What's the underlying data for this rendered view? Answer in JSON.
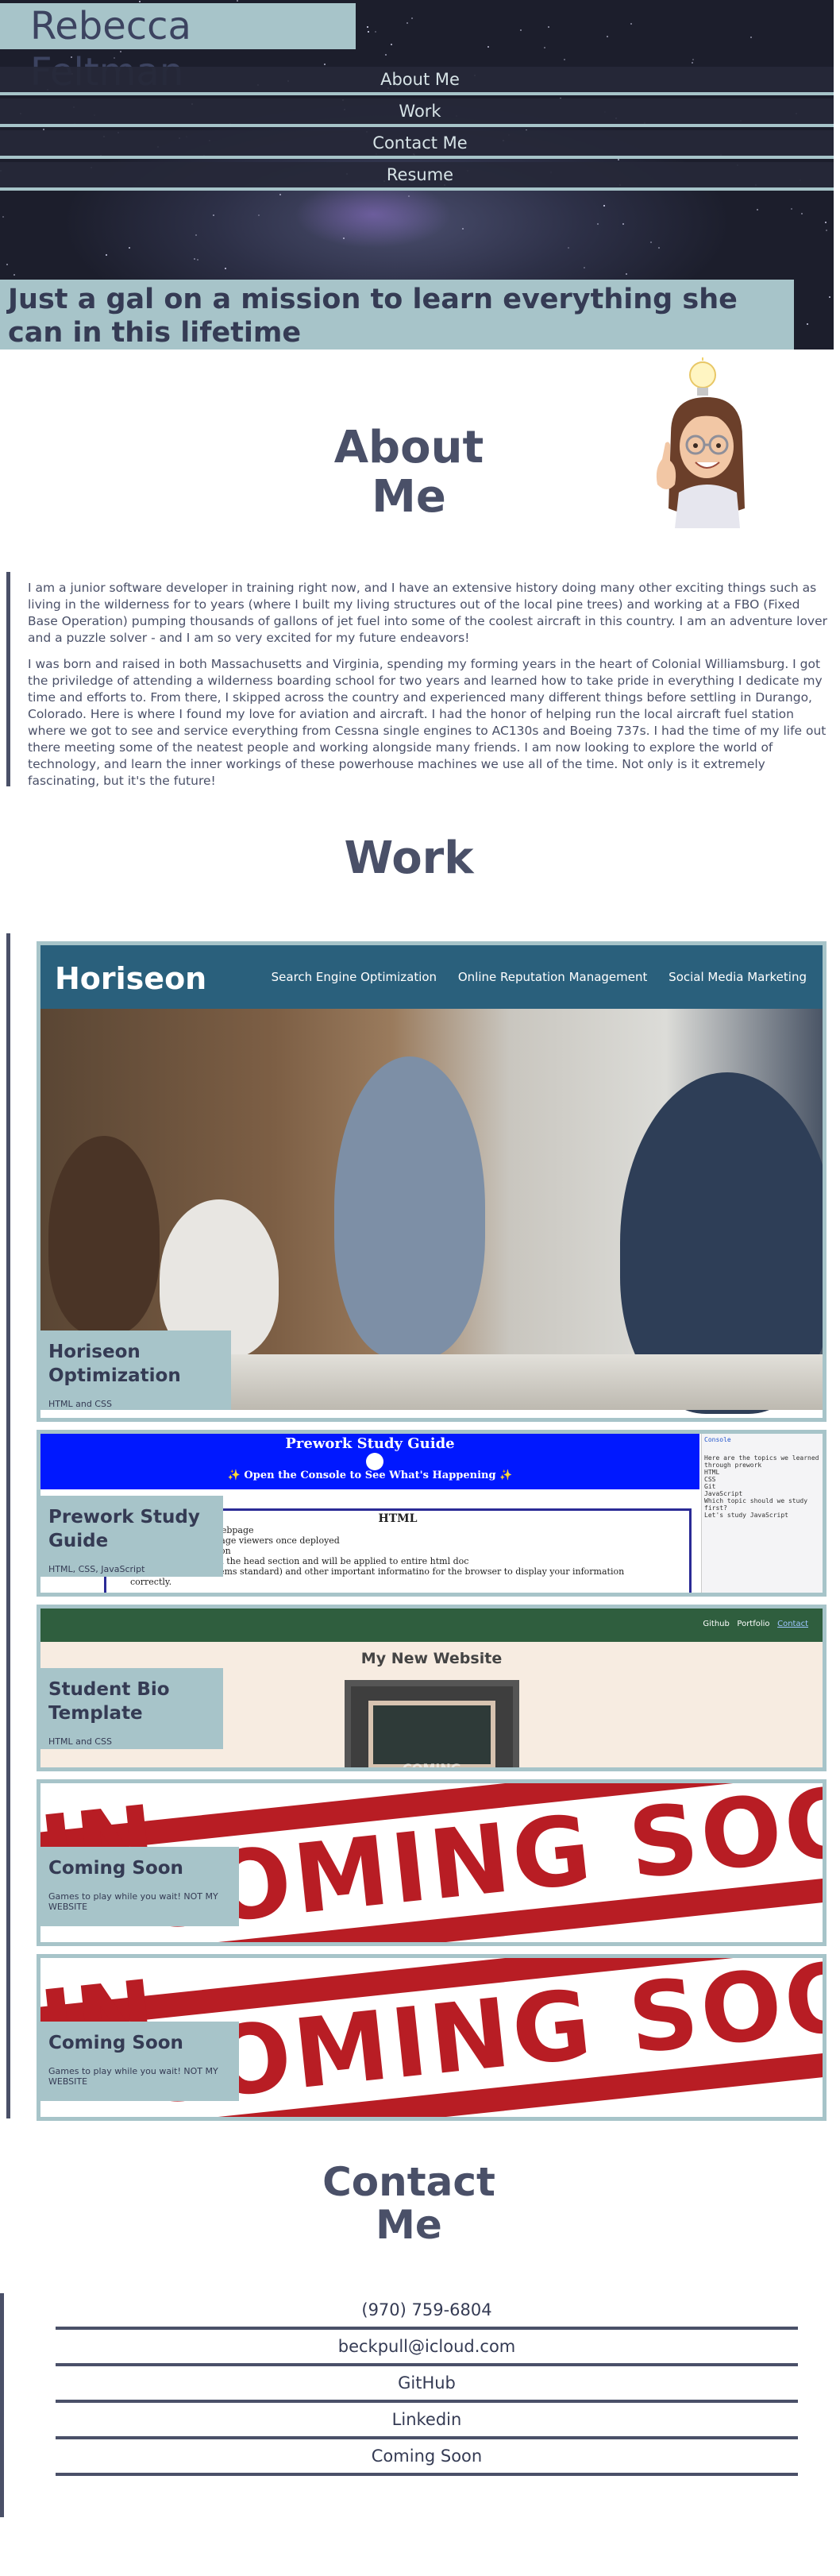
{
  "header": {
    "title": "Rebecca Feltman",
    "nav": [
      "About Me",
      "Work",
      "Contact Me",
      "Resume"
    ],
    "tagline": "Just a gal on a mission to learn everything she can in this lifetime"
  },
  "about": {
    "heading": "About Me",
    "paragraphs": [
      "I am a junior software developer in training right now, and I have an extensive history doing many other exciting things such as living in the wilderness for to years (where I built my living structures out of the local pine trees) and working at a FBO (Fixed Base Operation) pumping thousands of gallons of jet fuel into some of the coolest aircraft in this country. I am an adventure lover and a puzzle solver - and I am so very excited for my future endeavors!",
      "I was born and raised in both Massachusetts and Virginia, spending my forming years in the heart of Colonial Williamsburg. I got the priviledge of attending a wilderness boarding school for two years and learned how to take pride in everything I dedicate my time and efforts to. From there, I skipped across the country and experienced many different things before settling in Durango, Colorado. Here is where I found my love for aviation and aircraft. I had the honor of helping run the local aircraft fuel station where we got to see and service everything from Cessna single engines to AC130s and Boeing 737s. I had the time of my life out there meeting some of the neatest people and working alongside many friends. I am now looking to explore the world of technology, and learn the inner workings of these powerhouse machines we use all of the time. Not only is it extremely fascinating, but it's the future!"
    ]
  },
  "work": {
    "heading": "Work",
    "projects": [
      {
        "title": "Horiseon Optimization",
        "tech": "HTML and CSS"
      },
      {
        "title": "Prework Study Guide",
        "tech": "HTML, CSS, JavaScript"
      },
      {
        "title": "Student Bio Template",
        "tech": "HTML and CSS"
      },
      {
        "title": "Coming Soon",
        "tech": "Games to play while you wait! NOT MY WEBSITE"
      },
      {
        "title": "Coming Soon",
        "tech": "Games to play while you wait! NOT MY WEBSITE"
      }
    ],
    "horiseon": {
      "logo": "Horiseon",
      "nav": [
        "Search Engine Optimization",
        "Online Reputation Management",
        "Social Media Marketing"
      ]
    },
    "prework": {
      "title": "Prework Study Guide",
      "subtitle": "✨ Open the Console to See What's Happening ✨",
      "section": "HTML",
      "lines": [
        "information about the webpage",
        "nt is not visible to webpage viewers once deployed",
        "meta and title information",
        "pts can also be placed in the head section and will be applied to entire html doc",
        "character set (UTF-8 seems standard) and other important informatino for the browser to display your information",
        "correctly."
      ],
      "console": [
        "Console",
        "Here are the topics we learned through prework",
        "HTML",
        "CSS",
        "Git",
        "JavaScript",
        "Which topic should we study first?",
        "Let's study JavaScript"
      ]
    },
    "student_bio": {
      "nav": [
        "Github",
        "Portfolio",
        "Contact"
      ],
      "heading": "My New Website",
      "image_text": "COMING"
    },
    "coming_soon_text": "COMING SOO"
  },
  "contact": {
    "heading": "Contact Me",
    "items": [
      "(970) 759-6804",
      "beckpull@icloud.com",
      "GitHub",
      "Linkedin",
      "Coming Soon"
    ]
  }
}
